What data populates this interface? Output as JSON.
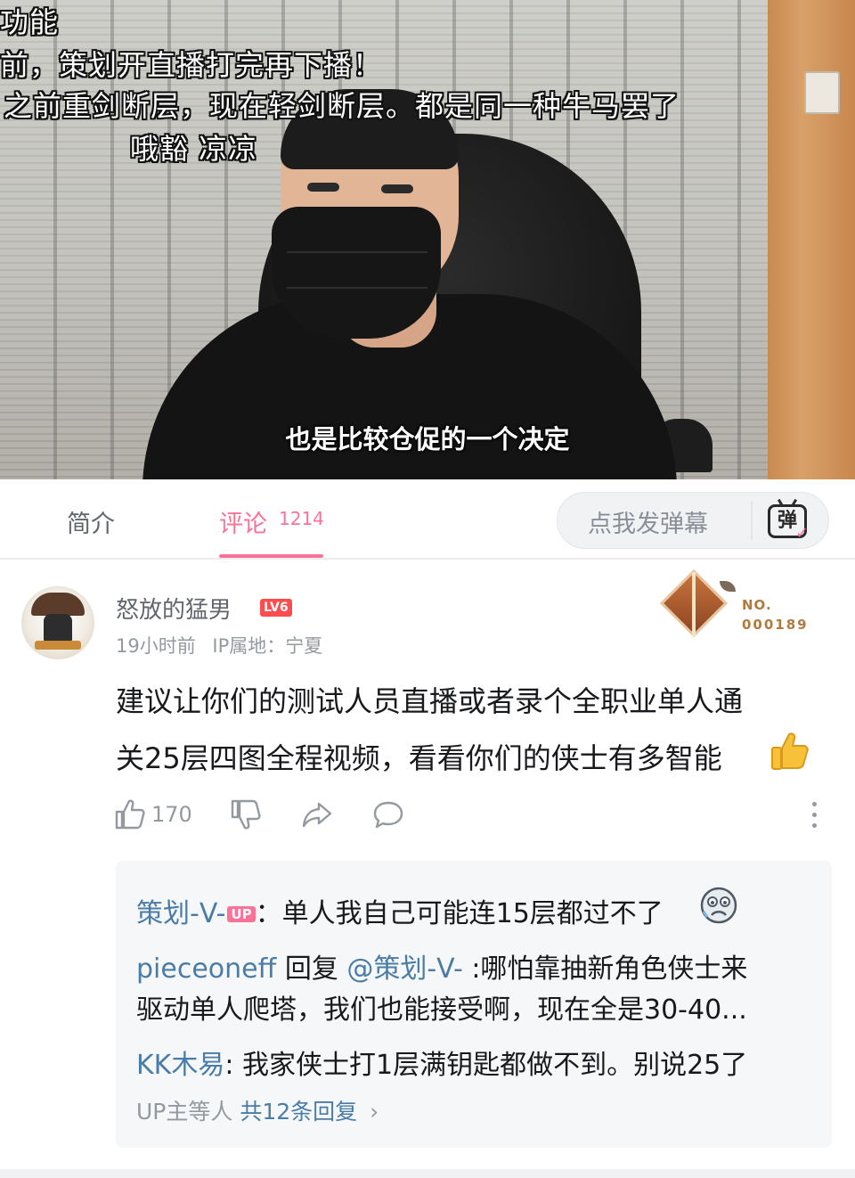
{
  "video": {
    "danmaku": [
      "功能",
      "前，策划开直播打完再下播！",
      "之前重剑断层，现在轻剑断层。都是同一种牛马罢了",
      "哦豁 凉凉"
    ],
    "subtitle": "也是比较仓促的一个决定"
  },
  "tabs": {
    "intro_label": "简介",
    "comments_label": "评论",
    "comments_count": "1214",
    "danmaku_placeholder": "点我发弹幕",
    "danmaku_button": "弹"
  },
  "comment": {
    "username": "怒放的猛男",
    "level": "LV6",
    "time": "19小时前",
    "ip": "IP属地：宁夏",
    "fan_badge_label": "NO.",
    "fan_badge_number": "000189",
    "content_lines": [
      "建议让你们的测试人员直播或者录个全职业单人通",
      "关25层四图全程视频，看看你们的侠士有多智能"
    ],
    "like_count": "170",
    "replies": [
      {
        "name": "策划-V-",
        "tag": "UP",
        "text": "：单人我自己可能连15层都过不了"
      },
      {
        "name": "pieceoneff",
        "reply_word": " 回复 ",
        "target": "@策划-V-",
        "text": " :哪怕靠抽新角色侠士来"
      },
      {
        "text": "驱动单人爬塔，我们也能接受啊，现在全是30-40..."
      },
      {
        "name": "KK木易",
        "text": ": 我家侠士打1层满钥匙都做不到。别说25了"
      }
    ],
    "reply_summary_prefix": "UP主等人 ",
    "reply_summary_total": "共12条回复",
    "reply_summary_arrow": "›"
  },
  "colors": {
    "accent": "#fb7299",
    "link": "#4a7ca8",
    "text": "#18191c",
    "muted": "#9499a0"
  }
}
